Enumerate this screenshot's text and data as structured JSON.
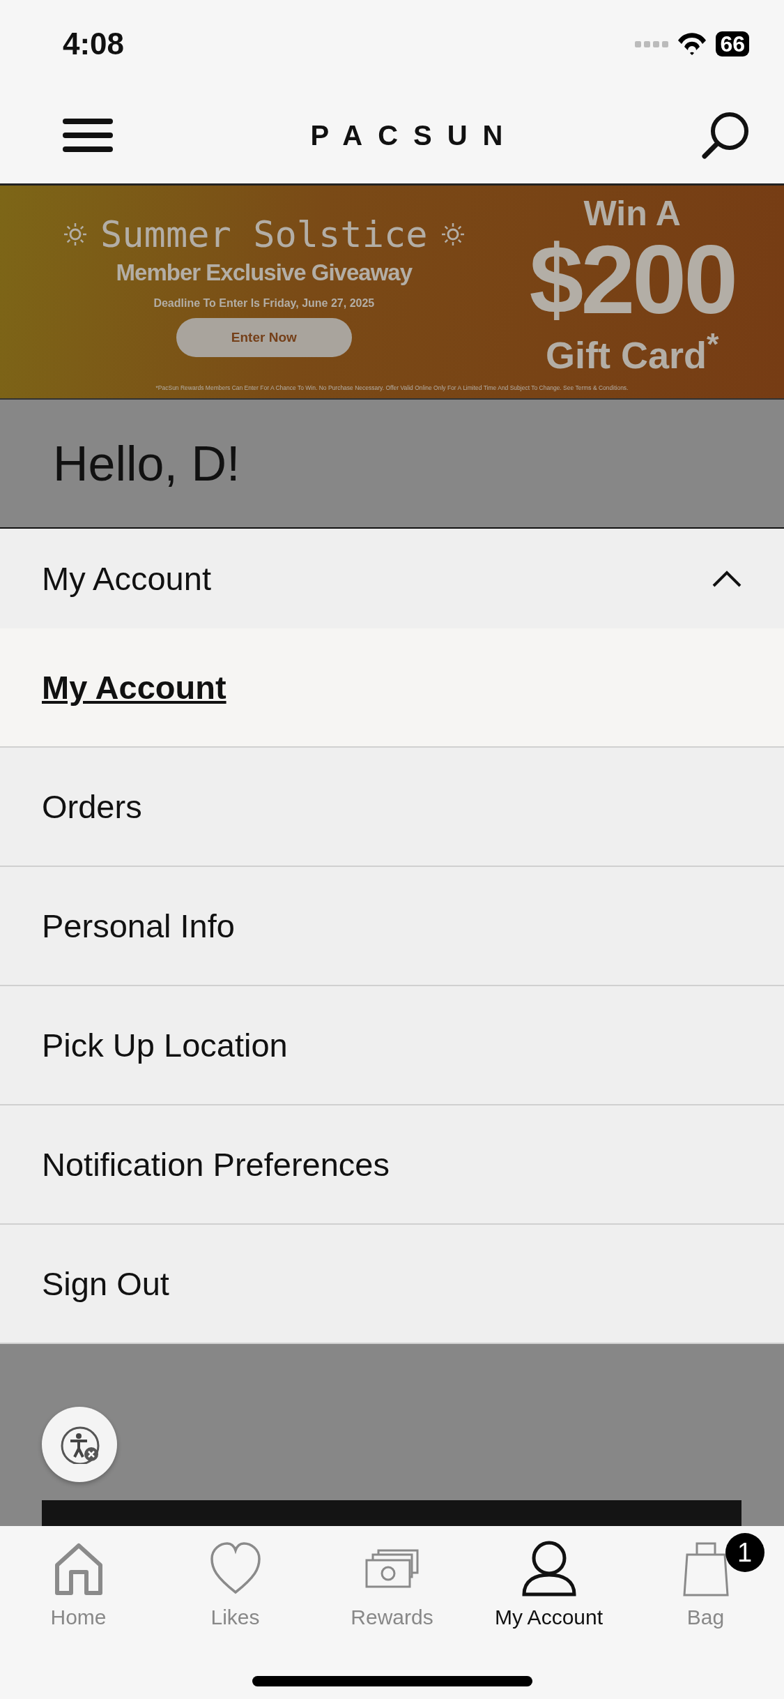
{
  "status_bar": {
    "time": "4:08",
    "battery": "66"
  },
  "header": {
    "logo": "PACSUN"
  },
  "banner": {
    "title": "Summer Solstice",
    "subtitle": "Member Exclusive Giveaway",
    "deadline": "Deadline To Enter Is Friday, June 27, 2025",
    "button": "Enter Now",
    "prize_top": "Win A",
    "prize_amount": "$200",
    "prize_bottom": "Gift Card",
    "prize_mark": "*",
    "fine_print": "*PacSun Rewards Members Can Enter For A Chance To Win. No Purchase Necessary. Offer Valid Online Only For A Limited Time And Subject To Change. See Terms & Conditions."
  },
  "greeting": "Hello, D!",
  "account_menu": {
    "label": "My Account",
    "expanded": true,
    "items": [
      {
        "label": "My Account",
        "selected": true
      },
      {
        "label": "Orders",
        "selected": false
      },
      {
        "label": "Personal Info",
        "selected": false
      },
      {
        "label": "Pick Up Location",
        "selected": false
      },
      {
        "label": "Notification Preferences",
        "selected": false
      },
      {
        "label": "Sign Out",
        "selected": false
      }
    ]
  },
  "tab_bar": [
    {
      "kind": "home",
      "label": "Home",
      "selected": false
    },
    {
      "kind": "likes",
      "label": "Likes",
      "selected": false
    },
    {
      "kind": "rewards",
      "label": "Rewards",
      "selected": false
    },
    {
      "kind": "account",
      "label": "My Account",
      "selected": true
    },
    {
      "kind": "bag",
      "label": "Bag",
      "selected": false,
      "badge": "1"
    }
  ]
}
